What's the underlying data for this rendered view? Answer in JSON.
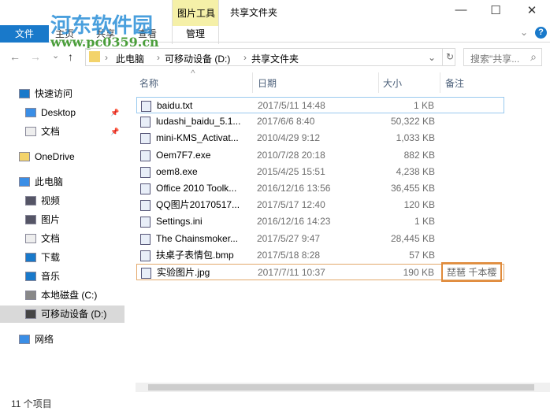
{
  "window": {
    "title": "共享文件夹",
    "context_group": "图片工具",
    "minimize": "—",
    "maximize": "☐",
    "close": "✕"
  },
  "watermark": {
    "name": "河东软件园",
    "url": "www.pc0359.cn"
  },
  "ribbon": {
    "tabs": [
      "文件",
      "主页",
      "共享",
      "查看",
      "管理"
    ],
    "help": "?",
    "expand": "⌄"
  },
  "address": {
    "back": "←",
    "forward": "→",
    "recent": "⌄",
    "up": "↑",
    "crumbs": [
      "此电脑",
      "可移动设备 (D:)",
      "共享文件夹"
    ],
    "sep": "›",
    "dropdown": "⌄",
    "refresh": "↻"
  },
  "search": {
    "placeholder": "搜索\"共享...",
    "icon": "⌕"
  },
  "sidebar": {
    "items": [
      {
        "label": "快速访问",
        "pin": ""
      },
      {
        "label": "Desktop",
        "pin": "📌"
      },
      {
        "label": "文档",
        "pin": "📌"
      },
      {
        "label": "OneDrive",
        "pin": ""
      },
      {
        "label": "此电脑",
        "pin": ""
      },
      {
        "label": "视频",
        "pin": ""
      },
      {
        "label": "图片",
        "pin": ""
      },
      {
        "label": "文档",
        "pin": ""
      },
      {
        "label": "下载",
        "pin": ""
      },
      {
        "label": "音乐",
        "pin": ""
      },
      {
        "label": "本地磁盘 (C:)",
        "pin": ""
      },
      {
        "label": "可移动设备 (D:)",
        "pin": ""
      },
      {
        "label": "网络",
        "pin": ""
      }
    ]
  },
  "columns": {
    "name": "名称",
    "date": "日期",
    "size": "大小",
    "note": "备注",
    "sort": "^"
  },
  "files": [
    {
      "name": "baidu.txt",
      "date": "2017/5/11 14:48",
      "size": "1 KB",
      "note": ""
    },
    {
      "name": "ludashi_baidu_5.1...",
      "date": "2017/6/6 8:40",
      "size": "50,322 KB",
      "note": ""
    },
    {
      "name": "mini-KMS_Activat...",
      "date": "2010/4/29 9:12",
      "size": "1,033 KB",
      "note": ""
    },
    {
      "name": "Oem7F7.exe",
      "date": "2010/7/28 20:18",
      "size": "882 KB",
      "note": ""
    },
    {
      "name": "oem8.exe",
      "date": "2015/4/25 15:51",
      "size": "4,238 KB",
      "note": ""
    },
    {
      "name": "Office 2010 Toolk...",
      "date": "2016/12/16 13:56",
      "size": "36,455 KB",
      "note": ""
    },
    {
      "name": "QQ图片20170517...",
      "date": "2017/5/17 12:40",
      "size": "120 KB",
      "note": ""
    },
    {
      "name": "Settings.ini",
      "date": "2016/12/16 14:23",
      "size": "1 KB",
      "note": ""
    },
    {
      "name": "The Chainsmoker...",
      "date": "2017/5/27 9:47",
      "size": "28,445 KB",
      "note": ""
    },
    {
      "name": "扶桌子表情包.bmp",
      "date": "2017/5/18 8:28",
      "size": "57 KB",
      "note": ""
    },
    {
      "name": "实验图片.jpg",
      "date": "2017/7/11 10:37",
      "size": "190 KB",
      "note": "琵琶 千本樱"
    }
  ],
  "status": {
    "count": "11 个项目"
  }
}
